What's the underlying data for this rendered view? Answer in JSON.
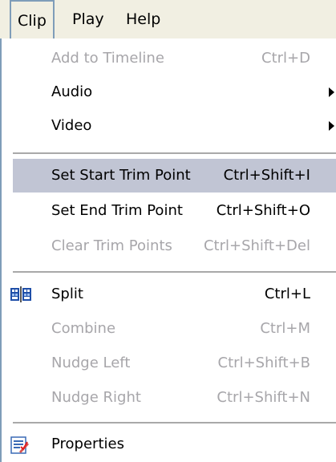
{
  "menubar": {
    "items": [
      {
        "label": "Clip",
        "active": true
      },
      {
        "label": "Play",
        "active": false
      },
      {
        "label": "Help",
        "active": false
      }
    ]
  },
  "menu": {
    "groups": [
      [
        {
          "label": "Add to Timeline",
          "shortcut": "Ctrl+D",
          "enabled": false,
          "submenu": false
        },
        {
          "label": "Audio",
          "shortcut": "",
          "enabled": true,
          "submenu": true
        },
        {
          "label": "Video",
          "shortcut": "",
          "enabled": true,
          "submenu": true
        }
      ],
      [
        {
          "label": "Set Start Trim Point",
          "shortcut": "Ctrl+Shift+I",
          "enabled": true,
          "highlighted": true
        },
        {
          "label": "Set End Trim Point",
          "shortcut": "Ctrl+Shift+O",
          "enabled": true
        },
        {
          "label": "Clear Trim Points",
          "shortcut": "Ctrl+Shift+Del",
          "enabled": false
        }
      ],
      [
        {
          "label": "Split",
          "shortcut": "Ctrl+L",
          "enabled": true,
          "icon": "split-icon"
        },
        {
          "label": "Combine",
          "shortcut": "Ctrl+M",
          "enabled": false
        },
        {
          "label": "Nudge Left",
          "shortcut": "Ctrl+Shift+B",
          "enabled": false
        },
        {
          "label": "Nudge Right",
          "shortcut": "Ctrl+Shift+N",
          "enabled": false
        }
      ],
      [
        {
          "label": "Properties",
          "shortcut": "",
          "enabled": true,
          "icon": "properties-icon"
        }
      ]
    ]
  },
  "colors": {
    "highlight": "#c1c5d4",
    "disabled_text": "#a7a6aa",
    "menubar_bg": "#f1efe2",
    "border": "#7f9db9"
  }
}
